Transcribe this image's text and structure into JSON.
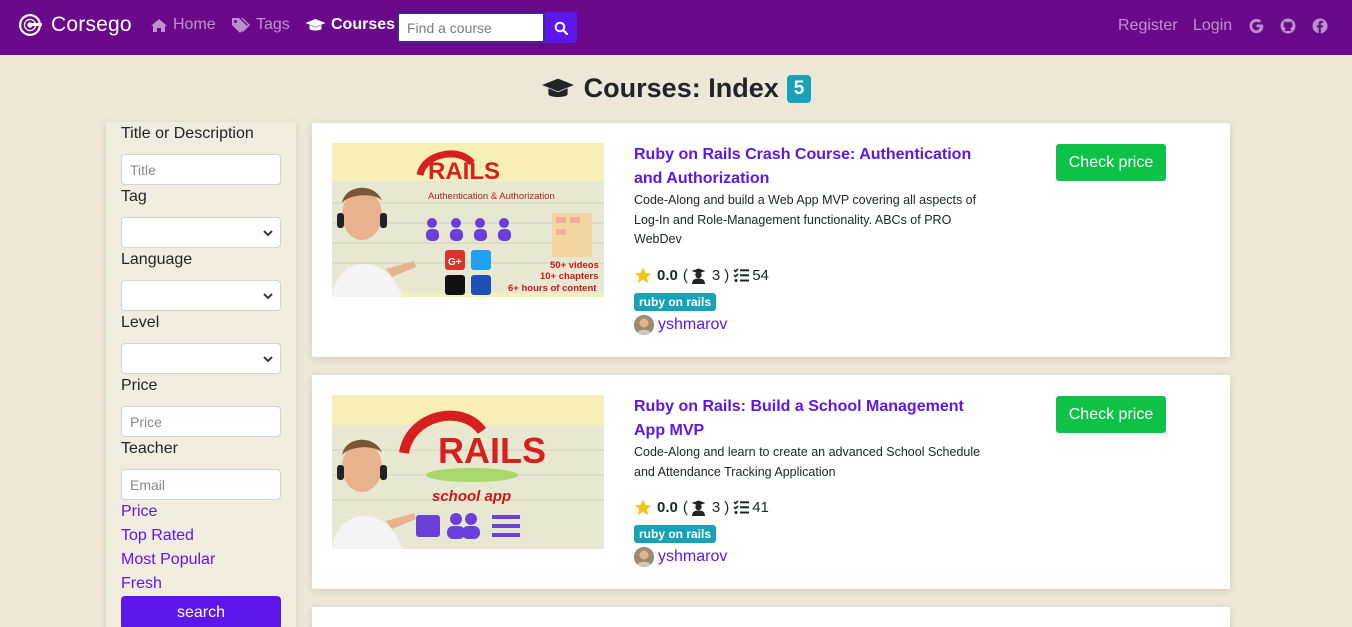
{
  "nav": {
    "brand": "Corsego",
    "home": "Home",
    "tags": "Tags",
    "courses": "Courses",
    "search_placeholder": "Find a course",
    "register": "Register",
    "login": "Login"
  },
  "header": {
    "title": "Courses: Index",
    "count": "5"
  },
  "sidebar": {
    "title_label": "Title or Description",
    "title_placeholder": "Title",
    "tag_label": "Tag",
    "language_label": "Language",
    "level_label": "Level",
    "price_label": "Price",
    "price_placeholder": "Price",
    "teacher_label": "Teacher",
    "teacher_placeholder": "Email",
    "sort_links": [
      "Price",
      "Top Rated",
      "Most Popular",
      "Fresh"
    ],
    "search_button": "search"
  },
  "courses": [
    {
      "title": "Ruby on Rails Crash Course: Authentication and Authorization",
      "description": "Code-Along and build a Web App MVP covering all aspects of Log-In and Role-Management functionality. ABCs of PRO WebDev",
      "rating": "0.0",
      "enrollments_open": "(",
      "enrollments": "3",
      "enrollments_close": ")",
      "lessons": "54",
      "tag": "ruby on rails",
      "author": "yshmarov",
      "price_button": "Check price",
      "thumb_subtitle": "Authentication & Authorization",
      "thumb_notes": [
        "50+ videos",
        "10+ chapters",
        "6+ hours of content"
      ]
    },
    {
      "title": "Ruby on Rails: Build a School Management App MVP",
      "description": "Code-Along and learn to create an advanced School Schedule and Attendance Tracking Application",
      "rating": "0.0",
      "enrollments_open": "(",
      "enrollments": "3",
      "enrollments_close": ")",
      "lessons": "41",
      "tag": "ruby on rails",
      "author": "yshmarov",
      "price_button": "Check price",
      "thumb_subtitle": "school app"
    }
  ],
  "colors": {
    "navbar": "#6a0a8a",
    "accent": "#5d17eb",
    "background": "#ece7d7",
    "badge": "#17a2b8",
    "price_button": "#0ec247"
  }
}
